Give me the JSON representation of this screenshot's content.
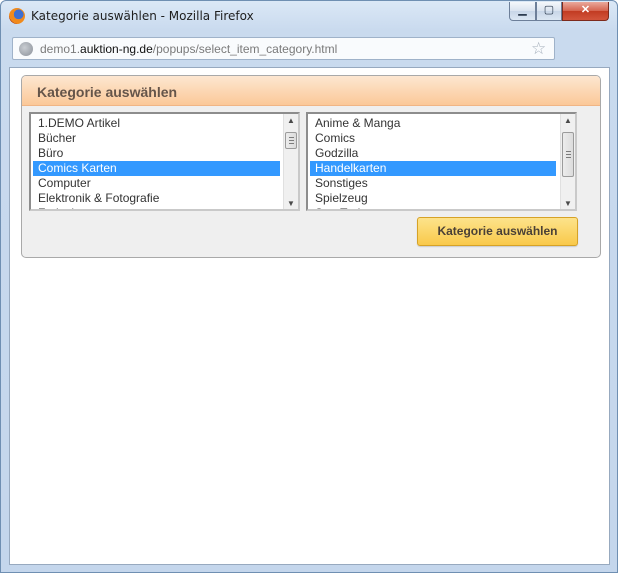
{
  "window": {
    "title": "Kategorie auswählen - Mozilla Firefox",
    "min_glyph": "▁",
    "max_glyph": "▢",
    "close_glyph": "✕"
  },
  "urlbar": {
    "prefix": "demo1.",
    "domain": "auktion-ng.de",
    "path": "/popups/select_item_category.html"
  },
  "panel": {
    "title": "Kategorie auswählen",
    "button_label": "Kategorie auswählen"
  },
  "left_list": {
    "selected": "Comics Karten",
    "options": [
      "1.DEMO Artikel",
      "Bücher",
      "Büro",
      "Comics Karten",
      "Computer",
      "Elektronik & Fotografie",
      "Freizeit"
    ]
  },
  "right_list": {
    "selected": "Handelkarten",
    "options": [
      "Anime & Manga",
      "Comics",
      "Godzilla",
      "Handelkarten",
      "Sonstiges",
      "Spielzeug",
      "Star Trek"
    ]
  },
  "colors": {
    "selection": "#3399ff",
    "panel_header": "#fbc898",
    "button": "#f9c94a"
  },
  "icons": {
    "app": "firefox-icon",
    "globe": "globe-icon",
    "bookmark": "star-icon"
  }
}
